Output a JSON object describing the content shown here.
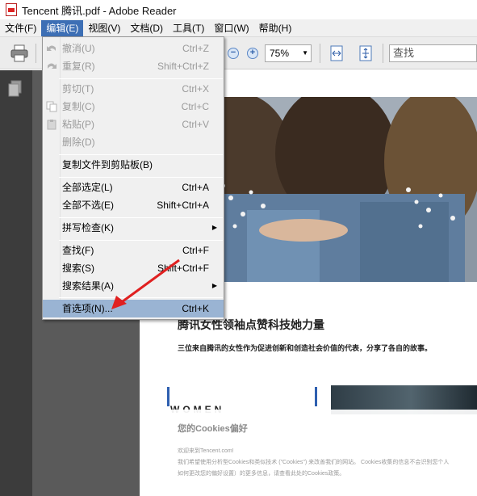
{
  "window": {
    "title": "Tencent 腾讯.pdf - Adobe Reader"
  },
  "menubar": [
    "文件(F)",
    "编辑(E)",
    "视图(V)",
    "文档(D)",
    "工具(T)",
    "窗口(W)",
    "帮助(H)"
  ],
  "toolbar": {
    "zoom": "75%",
    "search_placeholder": "查找"
  },
  "edit_menu": {
    "items": [
      {
        "label": "撤消(U)",
        "shortcut": "Ctrl+Z",
        "disabled": true
      },
      {
        "label": "重复(R)",
        "shortcut": "Shift+Ctrl+Z",
        "disabled": true
      },
      {
        "label": "剪切(T)",
        "shortcut": "Ctrl+X",
        "disabled": true
      },
      {
        "label": "复制(C)",
        "shortcut": "Ctrl+C",
        "disabled": true
      },
      {
        "label": "粘贴(P)",
        "shortcut": "Ctrl+V",
        "disabled": true
      },
      {
        "label": "删除(D)",
        "shortcut": "",
        "disabled": true
      },
      {
        "label": "复制文件到剪贴板(B)",
        "shortcut": "",
        "disabled": false
      },
      {
        "label": "全部选定(L)",
        "shortcut": "Ctrl+A",
        "disabled": false
      },
      {
        "label": "全部不选(E)",
        "shortcut": "Shift+Ctrl+A",
        "disabled": false
      },
      {
        "label": "拼写检查(K)",
        "shortcut": "",
        "disabled": false
      },
      {
        "label": "查找(F)",
        "shortcut": "Ctrl+F",
        "disabled": false
      },
      {
        "label": "搜索(S)",
        "shortcut": "Shift+Ctrl+F",
        "disabled": false
      },
      {
        "label": "搜索结果(A)",
        "shortcut": "",
        "disabled": false
      },
      {
        "label": "首选项(N)...",
        "shortcut": "Ctrl+K",
        "disabled": false
      }
    ]
  },
  "document": {
    "date_fragment": "7",
    "headline": "腾讯女性领袖点赞科技她力量",
    "subline": "三位来自腾讯的女性作为促进创新和创造社会价值的代表，分享了各自的故事。",
    "women": "WOMEN",
    "cookie_title": "您的Cookies偏好",
    "cookie_lines": [
      "欢迎来到Tencent.com!",
      "我们希望使用分析型Cookies和类似技术 (\"Cookies\") 来改善我们的网站。 Cookies收集的信息不会识别您个人",
      "如何更改您的偏好设置）的更多信息，请查看此处的Cookies政策。"
    ]
  },
  "colors": {
    "menu_highlight": "#9ab4d3",
    "menubar_active": "#3d6fb5",
    "annotation_arrow": "#e02020"
  }
}
